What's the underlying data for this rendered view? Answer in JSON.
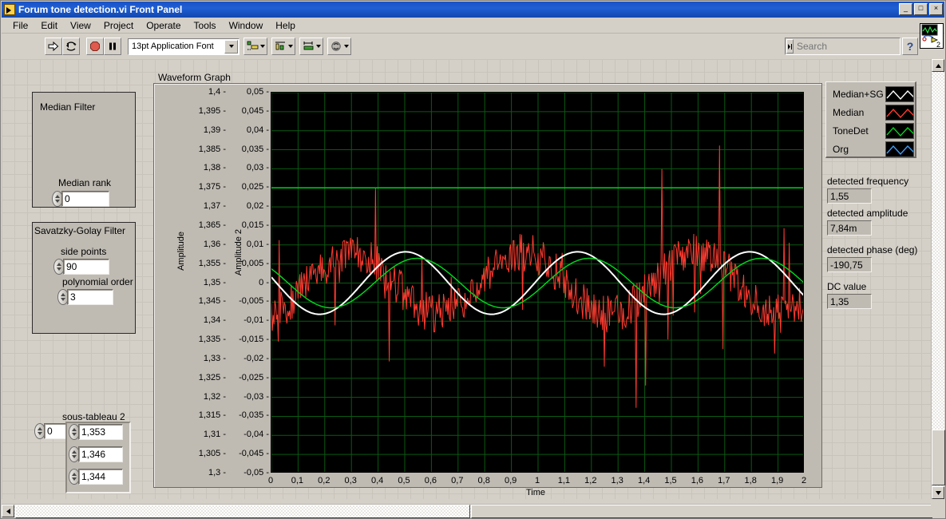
{
  "window": {
    "title": "Forum tone detection.vi Front Panel",
    "minimize_label": "_",
    "maximize_label": "□",
    "close_label": "×"
  },
  "menu": {
    "items": [
      {
        "label": "File"
      },
      {
        "label": "Edit"
      },
      {
        "label": "View"
      },
      {
        "label": "Project"
      },
      {
        "label": "Operate"
      },
      {
        "label": "Tools"
      },
      {
        "label": "Window"
      },
      {
        "label": "Help"
      }
    ]
  },
  "toolbar": {
    "run_icon": "run-arrow-icon",
    "run_continuous_icon": "run-continuously-icon",
    "abort_icon": "abort-stop-icon",
    "pause_icon": "pause-icon",
    "font_selector_value": "13pt Application Font",
    "align_icon": "align-objects-icon",
    "distribute_icon": "distribute-objects-icon",
    "resize_icon": "resize-objects-icon",
    "reorder_icon": "reorder-objects-icon",
    "search_placeholder": "Search",
    "search_value": "",
    "search_icon": "magnifier-icon",
    "help_label": "?",
    "vi_badge_number": "2"
  },
  "median_filter": {
    "title": "Median Filter",
    "rank_label": "Median rank",
    "rank_value": "0"
  },
  "savgol_filter": {
    "title": "Savatzky-Golay Filter",
    "side_points_label": "side points",
    "side_points_value": "90",
    "poly_order_label": "polynomial order",
    "poly_order_value": "3"
  },
  "array_control": {
    "label": "sous-tableau 2",
    "index_value": "0",
    "elements": [
      "1,353",
      "1,346",
      "1,344"
    ]
  },
  "legend": {
    "items": [
      {
        "name": "Median+SG",
        "color": "#ffffff"
      },
      {
        "name": "Median",
        "color": "#ff3b30"
      },
      {
        "name": "ToneDet",
        "color": "#00d21e"
      },
      {
        "name": "Org",
        "color": "#3aa0ff"
      }
    ]
  },
  "indicators": [
    {
      "label": "detected frequency",
      "value": "1,55"
    },
    {
      "label": "detected amplitude",
      "value": "7,84m"
    },
    {
      "label": "detected phase (deg)",
      "value": "-190,75"
    },
    {
      "label": "DC value",
      "value": "1,35"
    }
  ],
  "chart_data": {
    "type": "line",
    "title": "Waveform Graph",
    "xlabel": "Time",
    "ylabel": "Amplitude",
    "ylabel2": "Amplitude 2",
    "grid": true,
    "grid_color": "#0a5a12",
    "plot_background": "#000000",
    "xlim": [
      0,
      2
    ],
    "xticks": [
      "0",
      "0,1",
      "0,2",
      "0,3",
      "0,4",
      "0,5",
      "0,6",
      "0,7",
      "0,8",
      "0,9",
      "1",
      "1,1",
      "1,2",
      "1,3",
      "1,4",
      "1,5",
      "1,6",
      "1,7",
      "1,8",
      "1,9",
      "2"
    ],
    "ylim": [
      1.3,
      1.4
    ],
    "yticks": [
      "1,4",
      "1,395",
      "1,39",
      "1,385",
      "1,38",
      "1,375",
      "1,37",
      "1,365",
      "1,36",
      "1,355",
      "1,35",
      "1,345",
      "1,34",
      "1,335",
      "1,33",
      "1,325",
      "1,32",
      "1,315",
      "1,31",
      "1,305",
      "1,3"
    ],
    "ylim2": [
      -0.05,
      0.05
    ],
    "yticks2": [
      "0,05",
      "0,045",
      "0,04",
      "0,035",
      "0,03",
      "0,025",
      "0,02",
      "0,015",
      "0,01",
      "0,005",
      "0",
      "-0,005",
      "-0,01",
      "-0,015",
      "-0,02",
      "-0,025",
      "-0,03",
      "-0,035",
      "-0,04",
      "-0,045",
      "-0,05"
    ],
    "legend_position": "outside-right",
    "series": [
      {
        "name": "Median",
        "color": "#ff3b30",
        "style": "noisy-signal",
        "axis": "left",
        "amplitude": 0.008,
        "frequency": 1.55,
        "noise": 0.012,
        "dc": 1.35
      },
      {
        "name": "Median+SG",
        "color": "#ffffff",
        "style": "smooth-sine",
        "axis": "left",
        "amplitude": 0.0082,
        "frequency": 1.55,
        "phase": -190.75,
        "dc": 1.35
      },
      {
        "name": "ToneDet",
        "color": "#00d21e",
        "style": "smooth-sine",
        "axis": "left",
        "amplitude": 0.0065,
        "frequency": 1.55,
        "phase": -215.0,
        "dc": 1.35
      },
      {
        "name": "Org",
        "color": "#3aa0ff",
        "style": "hidden",
        "axis": "right",
        "amplitude": 0.008,
        "frequency": 1.55
      }
    ],
    "marker_lines": [
      {
        "value": "1,375",
        "axis": "left",
        "color": "#00d21e"
      }
    ]
  }
}
